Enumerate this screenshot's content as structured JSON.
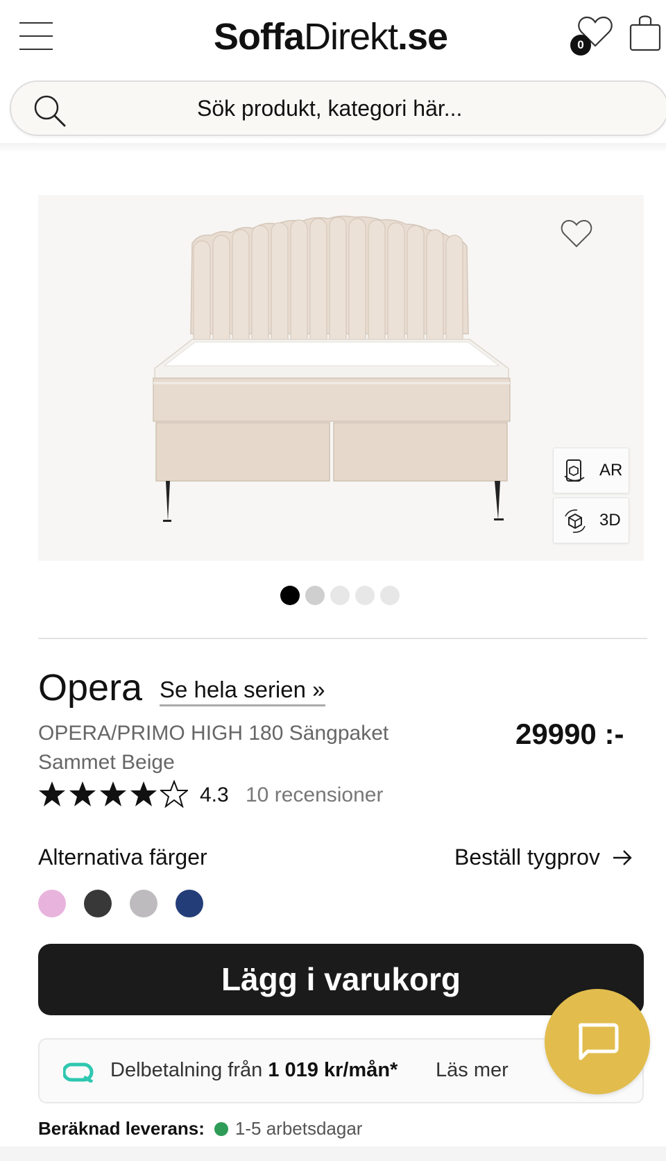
{
  "header": {
    "logo_part1": "Soffa",
    "logo_part2": "Direkt",
    "logo_part3": ".se",
    "wishlist_count": "0"
  },
  "search": {
    "placeholder": "Sök produkt, kategori här..."
  },
  "gallery": {
    "ar_label": "AR",
    "d3_label": "3D",
    "slide_count": 5,
    "active_slide": 1
  },
  "product": {
    "name": "Opera",
    "series_link": "Se hela serien »",
    "subtitle": "OPERA/PRIMO HIGH 180 Sängpaket Sammet Beige",
    "price": "29990 :-",
    "rating": "4.3",
    "rating_value": 4.3,
    "rating_max": 5,
    "reviews": "10 recensioner"
  },
  "colors": {
    "label": "Alternativa färger",
    "sample_link": "Beställ tygprov",
    "swatches": [
      "#e8b4dd",
      "#383838",
      "#bdbbbd",
      "#233d78"
    ]
  },
  "cart": {
    "label": "Lägg i varukorg"
  },
  "payment": {
    "prefix": "Delbetalning från",
    "amount": "1 019 kr/mån*",
    "more": "Läs mer"
  },
  "delivery": {
    "label": "Beräknad leverans:",
    "value": "1-5 arbetsdagar"
  },
  "theme": {
    "accent": "#e2bd4d",
    "button_dark": "#1b1b1b",
    "stock_green": "#2e9c57"
  }
}
